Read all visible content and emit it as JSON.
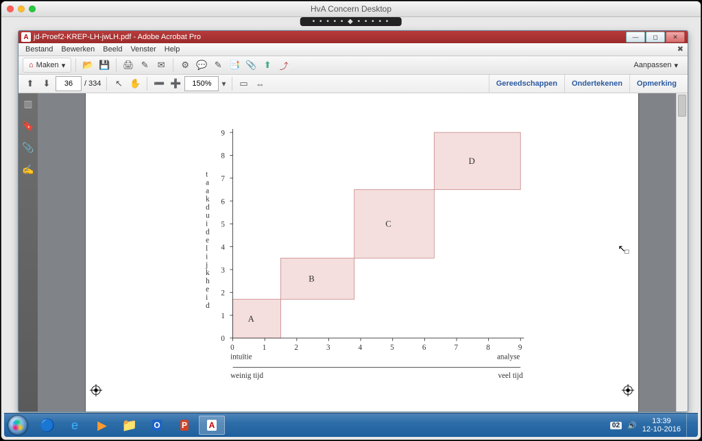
{
  "mac_title": "HvA Concern Desktop",
  "acrobat": {
    "title": "jd-Proef2-KREP-LH-jwLH.pdf - Adobe Acrobat Pro",
    "menu": [
      "Bestand",
      "Bewerken",
      "Beeld",
      "Venster",
      "Help"
    ],
    "maken_label": "Maken",
    "aanpassen_label": "Aanpassen",
    "page_current": "36",
    "page_total": "/ 334",
    "zoom_value": "150%",
    "tabs": {
      "tools": "Gereedschappen",
      "sign": "Ondertekenen",
      "comment": "Opmerking"
    }
  },
  "chart_data": {
    "type": "scatter",
    "x_ticks": [
      0,
      1,
      2,
      3,
      4,
      5,
      6,
      7,
      8,
      9
    ],
    "y_ticks": [
      0,
      1,
      2,
      3,
      4,
      5,
      6,
      7,
      8,
      9
    ],
    "x_axis_end_labels": {
      "left": "intuïtie",
      "right": "analyse"
    },
    "x_secondary_labels": {
      "left": "weinig tijd",
      "right": "veel tijd"
    },
    "ylabel": "taakduidelijkheid",
    "boxes": [
      {
        "label": "A",
        "x0": 0,
        "x1": 1.5,
        "y0": 0,
        "y1": 1.7
      },
      {
        "label": "B",
        "x0": 1.5,
        "x1": 3.8,
        "y0": 1.7,
        "y1": 3.5
      },
      {
        "label": "C",
        "x0": 3.8,
        "x1": 6.3,
        "y0": 3.5,
        "y1": 6.5
      },
      {
        "label": "D",
        "x0": 6.3,
        "x1": 9.0,
        "y0": 6.5,
        "y1": 9.0
      }
    ]
  },
  "tray": {
    "lang": "02",
    "time": "13:39",
    "date": "12-10-2016"
  }
}
